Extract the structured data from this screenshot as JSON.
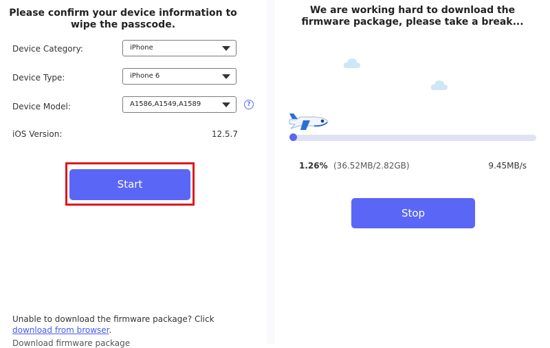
{
  "left": {
    "heading_line1": "Please confirm your device information to",
    "heading_line2": "wipe the passcode.",
    "device_category": {
      "label": "Device Category:",
      "value": "iPhone"
    },
    "device_type": {
      "label": "Device Type:",
      "value": "iPhone 6"
    },
    "device_model": {
      "label": "Device Model:",
      "value": "A1586,A1549,A1589"
    },
    "ios_version": {
      "label": "iOS Version:",
      "value": "12.5.7"
    },
    "start_label": "Start",
    "footer_text": "Unable to download the firmware package? Click ",
    "footer_link": "download from browser",
    "footer_period": ".",
    "footer_cut": "Download firmware package"
  },
  "right": {
    "heading_line1": "We are working hard to download the",
    "heading_line2": "firmware package, please take a break...",
    "progress_percent": "1.26%",
    "progress_fraction": 0.0126,
    "size_text": "(36.52MB/2.82GB)",
    "speed_text": "9.45MB/s",
    "stop_label": "Stop"
  },
  "colors": {
    "accent": "#5a66f5",
    "highlight": "#e0161b",
    "link": "#4b58f0"
  },
  "icons": [
    "cloud-icon",
    "airplane-icon",
    "help-icon",
    "dropdown-arrow-icon"
  ]
}
